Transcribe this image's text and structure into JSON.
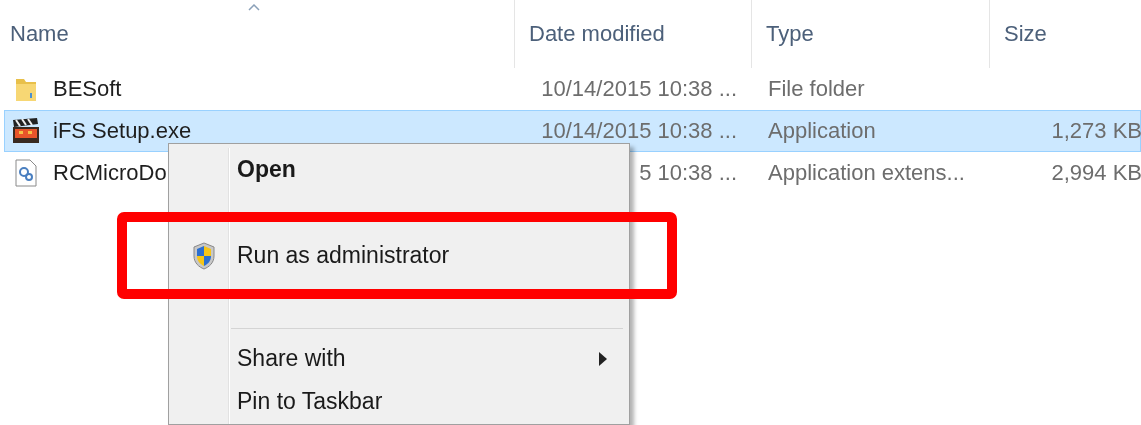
{
  "columns": [
    {
      "label": "Name",
      "sorted": true
    },
    {
      "label": "Date modified",
      "sorted": false
    },
    {
      "label": "Type",
      "sorted": false
    },
    {
      "label": "Size",
      "sorted": false
    }
  ],
  "files": [
    {
      "kind": "folder",
      "name": "BESoft",
      "date": "10/14/2015 10:38 ...",
      "type": "File folder",
      "selected": false
    },
    {
      "kind": "application",
      "name": "iFS Setup.exe",
      "date": "10/14/2015 10:38 ...",
      "type": "Application",
      "size": "1,273 KB",
      "selected": true
    },
    {
      "kind": "extension",
      "name": "RCMicroDo",
      "date": "5 10:38 ...",
      "type": "Application extens...",
      "size": "2,994 KB",
      "selected": false
    }
  ],
  "context_menu": {
    "items": [
      {
        "kind": "item",
        "label": "Open",
        "bold": true,
        "shield": false,
        "submenu": false,
        "annotated": false
      },
      {
        "kind": "covered"
      },
      {
        "kind": "item",
        "label": "Run as administrator",
        "bold": false,
        "shield": true,
        "submenu": false,
        "annotated": true
      },
      {
        "kind": "covered"
      },
      {
        "kind": "separator"
      },
      {
        "kind": "item",
        "label": "Share with",
        "bold": false,
        "shield": false,
        "submenu": true,
        "annotated": false
      },
      {
        "kind": "item",
        "label": "Pin to Taskbar",
        "bold": false,
        "shield": false,
        "submenu": false,
        "annotated": false
      }
    ]
  }
}
